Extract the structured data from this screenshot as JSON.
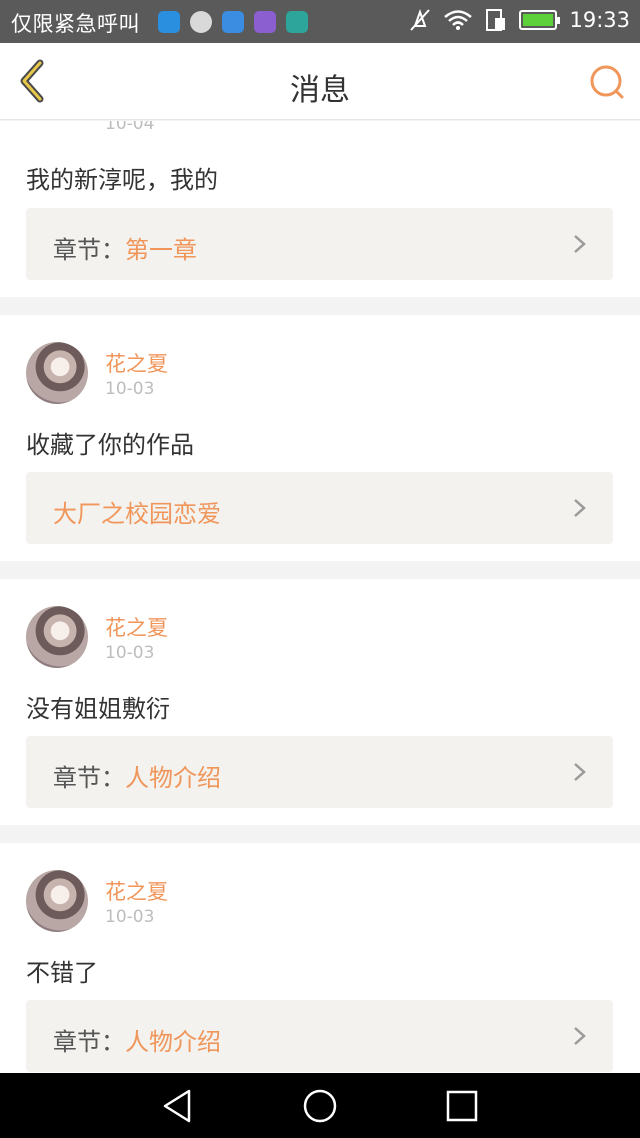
{
  "status_bar": {
    "carrier": "仅限紧急呼叫",
    "time": "19:33",
    "app_icon_colors": [
      "#2b8fe0",
      "#d9d9d9",
      "#3a8de0",
      "#8b5fd0",
      "#2ea59a"
    ]
  },
  "header": {
    "title": "消息",
    "accent_color": "#f0965b",
    "back_color": "#e8c84a"
  },
  "messages": [
    {
      "user": "",
      "date": "10-04",
      "text": "我的新淳呢，我的",
      "ref_label": "章节：",
      "ref_value": "第一章"
    },
    {
      "user": "花之夏",
      "date": "10-03",
      "text": "收藏了你的作品",
      "ref_label": "",
      "ref_value": "大厂之校园恋爱"
    },
    {
      "user": "花之夏",
      "date": "10-03",
      "text": "没有姐姐敷衍",
      "ref_label": "章节：",
      "ref_value": "人物介绍"
    },
    {
      "user": "花之夏",
      "date": "10-03",
      "text": "不错了",
      "ref_label": "章节：",
      "ref_value": "人物介绍"
    }
  ]
}
